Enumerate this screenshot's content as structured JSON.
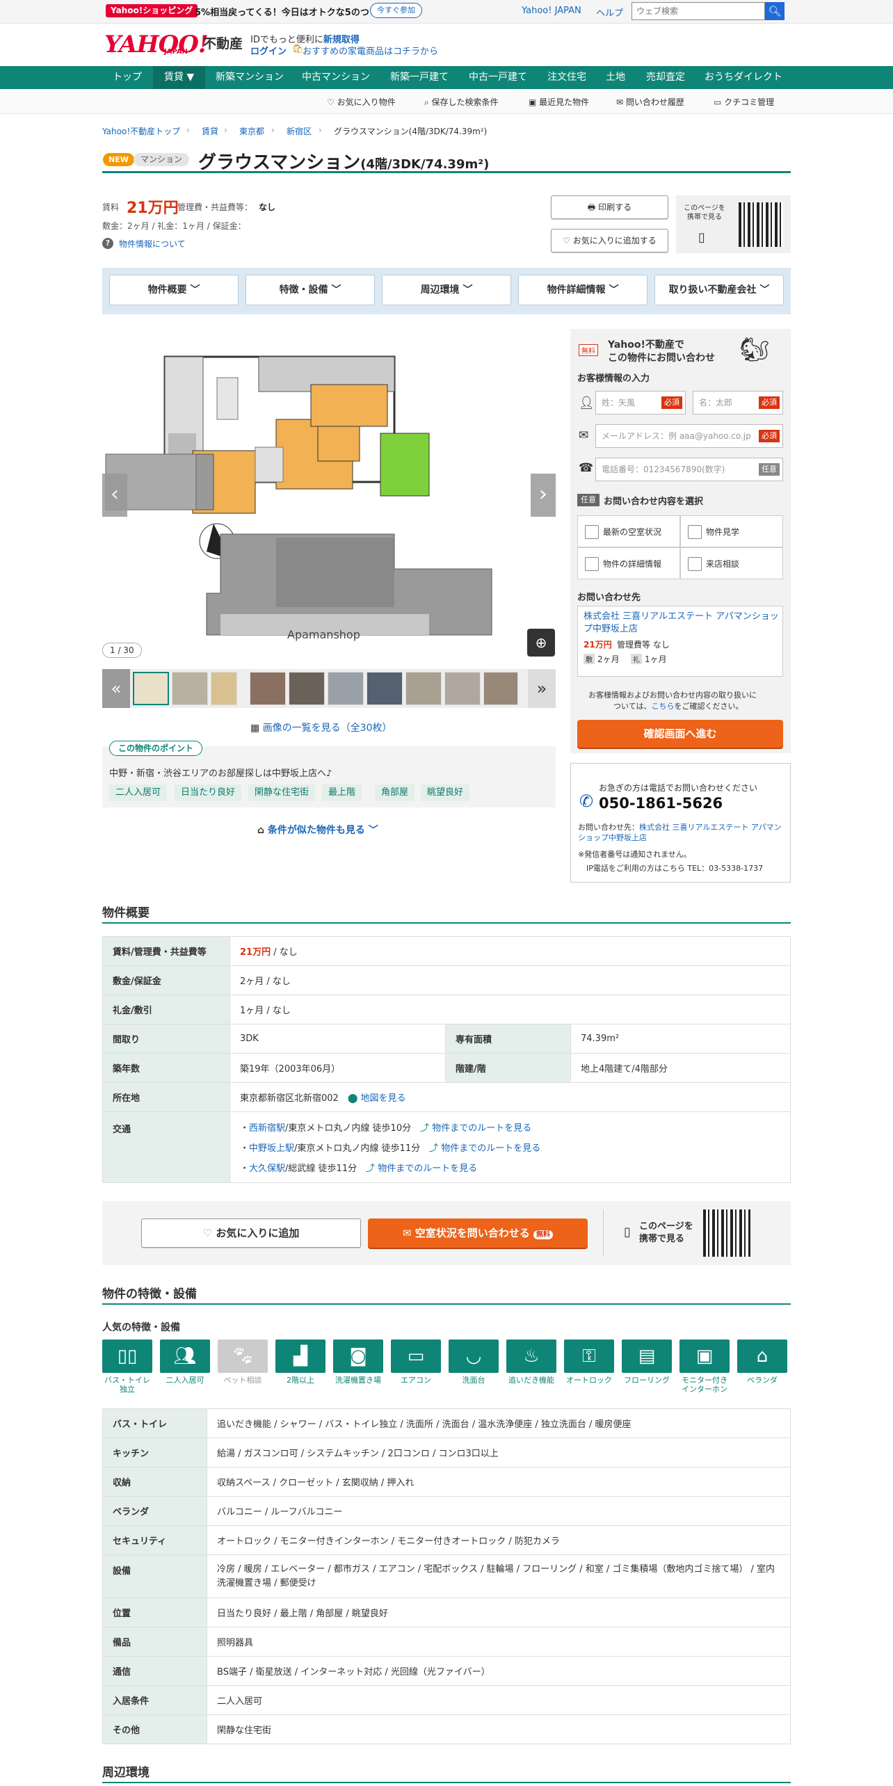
{
  "topbar": {
    "shopping_badge": "Yahoo!ショッピング",
    "promo_text": "5%相当戻ってくる！今日はオトクな5のつく日",
    "join_btn": "今すぐ参加",
    "yahoo_japan": "Yahoo! JAPAN",
    "help": "ヘルプ",
    "search_placeholder": "ウェブ検索"
  },
  "header": {
    "logo": "YAHOO!",
    "logo_sub": "JAPAN",
    "service": "不動産",
    "id_text": "IDでもっと便利に",
    "signup": "新規取得",
    "login": "ログイン",
    "promo": "おすすめの家電商品はコチラから"
  },
  "gnav": [
    "トップ",
    "賃貸 ▼",
    "新築マンション",
    "中古マンション",
    "新築一戸建て",
    "中古一戸建て",
    "注文住宅",
    "土地",
    "売却査定",
    "おうちダイレクト"
  ],
  "subnav": [
    "お気に入り物件",
    "保存した検索条件",
    "最近見た物件",
    "問い合わせ履歴",
    "クチコミ管理"
  ],
  "breadcrumb": [
    "Yahoo!不動産トップ",
    "賃貸",
    "東京都",
    "新宿区",
    "グラウスマンション(4階/3DK/74.39m²)"
  ],
  "title": {
    "new_badge": "NEW",
    "type_badge": "マンション",
    "name": "グラウスマンション",
    "detail": "(4階/3DK/74.39m²)"
  },
  "price": {
    "rent_label": "賃料",
    "rent": "21万円",
    "fee_label": "管理費・共益費等：",
    "fee": "なし",
    "line2": "敷金：2ヶ月 / 礼金：1ヶ月 / 保証金：",
    "info_link": "物件情報について"
  },
  "actions": {
    "print": "印刷する",
    "favorite": "お気に入りに追加する",
    "mobile": "このページを携帯で見る"
  },
  "tabs": [
    "物件概要",
    "特徴・設備",
    "周辺環境",
    "物件詳細情報",
    "取り扱い不動産会社"
  ],
  "gallery": {
    "counter": "1 / 30",
    "watermark": "Apamanshop",
    "view_all": "画像の一覧を見る（全30枚）"
  },
  "point": {
    "title": "この物件のポイント",
    "text": "中野・新宿・渋谷エリアのお部屋探しは中野坂上店へ♪",
    "tags": [
      "二人入居可",
      "日当たり良好",
      "閑静な住宅街",
      "最上階",
      "角部屋",
      "眺望良好"
    ]
  },
  "similar": "条件が似た物件も見る",
  "contact": {
    "free": "無料",
    "heading1": "Yahoo!不動産で",
    "heading2": "この物件にお問い合わせ",
    "customer_info": "お客様情報の入力",
    "last_name_ph": "姓：矢風",
    "first_name_ph": "名：太郎",
    "email_ph": "メールアドレス：例 aaa@yahoo.co.jp",
    "tel_ph": "電話番号：01234567890(数字)",
    "required": "必須",
    "optional": "任意",
    "choose_label": "お問い合わせ内容を選択",
    "options": [
      "最新の空室状況",
      "物件見学",
      "物件の詳細情報",
      "来店相談"
    ],
    "to_label": "お問い合わせ先",
    "company": "株式会社 三喜リアルエステート アパマンショップ中野坂上店",
    "c_price": "21万円",
    "c_fee": "管理費等 なし",
    "c_shiki": "2ヶ月",
    "c_rei": "1ヶ月",
    "shiki_tag": "敷",
    "rei_tag": "礼",
    "note1": "お客様情報およびお問い合わせ内容の取り扱いに",
    "note2a": "ついては、",
    "note2link": "こちら",
    "note2b": "をご確認ください。",
    "confirm_btn": "確認画面へ進む"
  },
  "tel": {
    "heading": "お急ぎの方は電話でお問い合わせください",
    "number": "050-1861-5626",
    "to_prefix": "お問い合わせ先：",
    "to_company": "株式会社 三喜リアルエステート アパマンショップ中野坂上店",
    "note1": "※発信者番号は通知されません。",
    "note2": "IP電話をご利用の方はこちら TEL：03-5338-1737"
  },
  "overview": {
    "heading": "物件概要",
    "rows": {
      "rent_label": "賃料/管理費・共益費等",
      "rent_price": "21万円",
      "rent_rest": " / なし",
      "deposit_label": "敷金/保証金",
      "deposit": "2ヶ月 / なし",
      "key_label": "礼金/敷引",
      "key": "1ヶ月 / なし",
      "layout_label": "間取り",
      "layout": "3DK",
      "area_label": "専有面積",
      "area": "74.39m²",
      "age_label": "築年数",
      "age": "築19年（2003年06月）",
      "floor_label": "階建/階",
      "floor": "地上4階建て/4階部分",
      "address_label": "所在地",
      "address": "東京都新宿区北新宿002",
      "map_link": "地図を見る",
      "transport_label": "交通",
      "route_link": "物件までのルートを見る",
      "stations": [
        {
          "name": "西新宿駅",
          "line": "/東京メトロ丸ノ内線 徒歩10分"
        },
        {
          "name": "中野坂上駅",
          "line": "/東京メトロ丸ノ内線 徒歩11分"
        },
        {
          "name": "大久保駅",
          "line": "/総武線 徒歩11分"
        }
      ]
    }
  },
  "bottombar": {
    "fav": "お気に入りに追加",
    "inquire": "空室状況を問い合わせる",
    "free": "無料",
    "mobile": "このページを携帯で見る"
  },
  "features": {
    "heading": "物件の特徴・設備",
    "popular": "人気の特徴・設備",
    "icons": [
      {
        "label": "バス・トイレ独立",
        "icon": "bath-toilet-icon",
        "on": true
      },
      {
        "label": "二人入居可",
        "icon": "two-people-icon",
        "on": true
      },
      {
        "label": "ペット相談",
        "icon": "pet-icon",
        "on": false
      },
      {
        "label": "2階以上",
        "icon": "stairs-icon",
        "on": true
      },
      {
        "label": "洗濯機置き場",
        "icon": "washer-icon",
        "on": true
      },
      {
        "label": "エアコン",
        "icon": "aircon-icon",
        "on": true
      },
      {
        "label": "洗面台",
        "icon": "washbasin-icon",
        "on": true
      },
      {
        "label": "追いだき機能",
        "icon": "reheat-bath-icon",
        "on": true
      },
      {
        "label": "オートロック",
        "icon": "autolock-icon",
        "on": true
      },
      {
        "label": "フローリング",
        "icon": "flooring-icon",
        "on": true
      },
      {
        "label": "モニター付きインターホン",
        "icon": "monitor-intercom-icon",
        "on": true
      },
      {
        "label": "ベランダ",
        "icon": "balcony-icon",
        "on": true
      }
    ],
    "rows": [
      {
        "label": "バス・トイレ",
        "value": "追いだき機能 / シャワー / バス・トイレ独立 / 洗面所 / 洗面台 / 温水洗浄便座 / 独立洗面台 / 暖房便座"
      },
      {
        "label": "キッチン",
        "value": "給湯 / ガスコンロ可 / システムキッチン / 2口コンロ / コンロ3口以上"
      },
      {
        "label": "収納",
        "value": "収納スペース / クローゼット / 玄関収納 / 押入れ"
      },
      {
        "label": "ベランダ",
        "value": "バルコニー / ルーフバルコニー"
      },
      {
        "label": "セキュリティ",
        "value": "オートロック / モニター付きインターホン / モニター付きオートロック / 防犯カメラ"
      },
      {
        "label": "設備",
        "value": "冷房 / 暖房 / エレベーター / 都市ガス / エアコン / 宅配ボックス / 駐輪場 / フローリング / 和室 / ゴミ集積場（敷地内ゴミ捨て場） / 室内洗濯機置き場 / 郵便受け"
      },
      {
        "label": "位置",
        "value": "日当たり良好 / 最上階 / 角部屋 / 眺望良好"
      },
      {
        "label": "備品",
        "value": "照明器具"
      },
      {
        "label": "通信",
        "value": "BS端子 / 衛星放送 / インターネット対応 / 光回線（光ファイバー）"
      },
      {
        "label": "入居条件",
        "value": "二人入居可"
      },
      {
        "label": "その他",
        "value": "閑静な住宅街"
      }
    ]
  },
  "surroundings": {
    "heading": "周辺環境"
  },
  "colors": {
    "primary": "#0f8577",
    "accent": "#ec6319",
    "price": "#d9330f",
    "link": "#1a66b8",
    "yahoo": "#e60033"
  }
}
